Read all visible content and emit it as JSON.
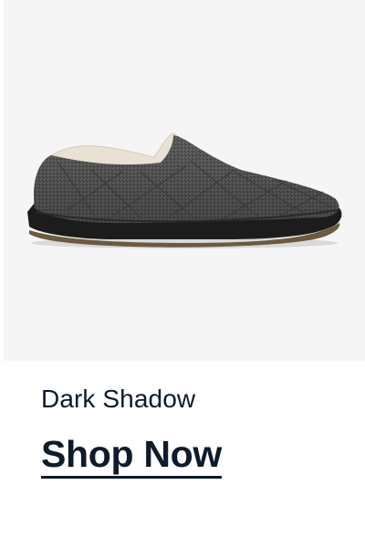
{
  "product": {
    "image_alt": "Gray quilted slipper with fleece lining",
    "color_name": "Dark Shadow",
    "cta_label": "Shop Now"
  },
  "colors": {
    "panel_bg": "#f5f5f5",
    "text": "#0d1b2a"
  }
}
